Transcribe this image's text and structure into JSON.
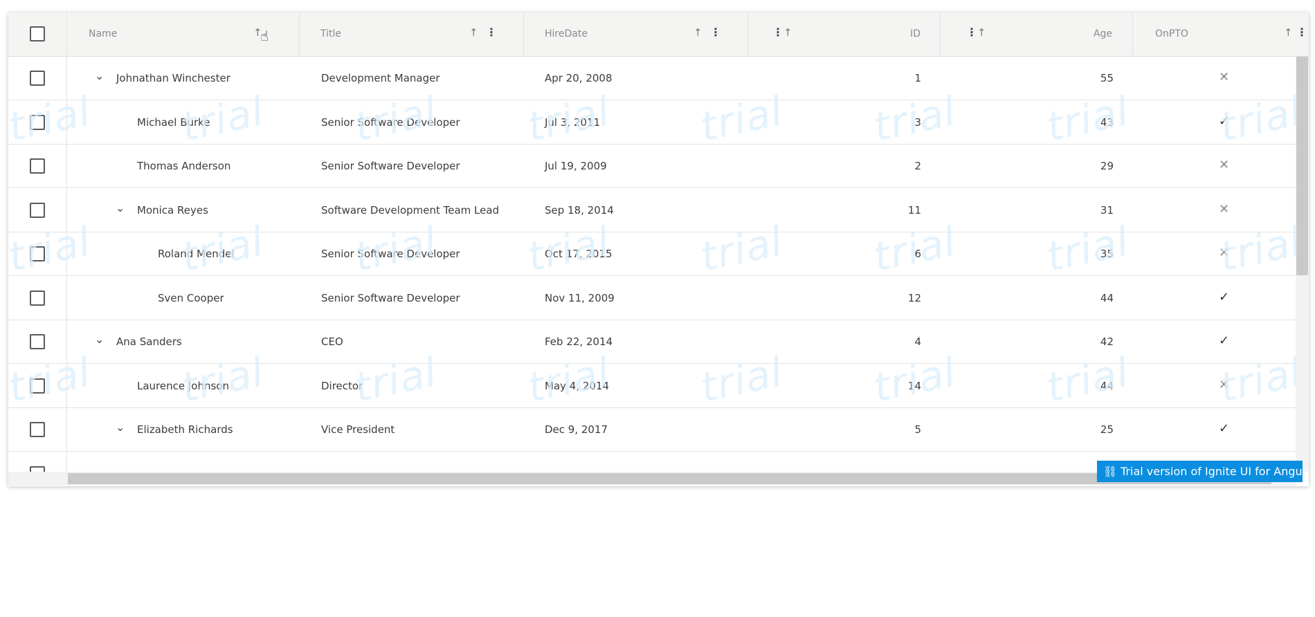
{
  "header": {
    "columns": [
      {
        "label": "Name",
        "sort_icon": "arrow-up-icon"
      },
      {
        "label": "Title",
        "sort_icon": "arrow-up-icon",
        "menu_icon": "more-vertical-icon"
      },
      {
        "label": "HireDate",
        "sort_icon": "arrow-up-icon",
        "menu_icon": "more-vertical-icon"
      },
      {
        "label": "ID",
        "sort_icon": "arrow-up-icon",
        "menu_icon": "more-vertical-icon"
      },
      {
        "label": "Age",
        "sort_icon": "arrow-up-icon",
        "menu_icon": "more-vertical-icon"
      },
      {
        "label": "OnPTO",
        "sort_icon": "arrow-up-icon",
        "menu_icon": "more-vertical-icon"
      }
    ]
  },
  "rows": [
    {
      "name": "Johnathan Winchester",
      "title": "Development Manager",
      "hire": "Apr 20, 2008",
      "id": "1",
      "age": "55",
      "pto": "✕",
      "level": 0,
      "expand": "⌄"
    },
    {
      "name": "Michael Burke",
      "title": "Senior Software Developer",
      "hire": "Jul 3, 2011",
      "id": "3",
      "age": "43",
      "pto": "✓",
      "level": 1,
      "expand": ""
    },
    {
      "name": "Thomas Anderson",
      "title": "Senior Software Developer",
      "hire": "Jul 19, 2009",
      "id": "2",
      "age": "29",
      "pto": "✕",
      "level": 1,
      "expand": ""
    },
    {
      "name": "Monica Reyes",
      "title": "Software Development Team Lead",
      "hire": "Sep 18, 2014",
      "id": "11",
      "age": "31",
      "pto": "✕",
      "level": 1,
      "expand": "⌄"
    },
    {
      "name": "Roland Mendel",
      "title": "Senior Software Developer",
      "hire": "Oct 17, 2015",
      "id": "6",
      "age": "35",
      "pto": "✕",
      "level": 2,
      "expand": ""
    },
    {
      "name": "Sven Cooper",
      "title": "Senior Software Developer",
      "hire": "Nov 11, 2009",
      "id": "12",
      "age": "44",
      "pto": "✓",
      "level": 2,
      "expand": ""
    },
    {
      "name": "Ana Sanders",
      "title": "CEO",
      "hire": "Feb 22, 2014",
      "id": "4",
      "age": "42",
      "pto": "✓",
      "level": 0,
      "expand": "⌄"
    },
    {
      "name": "Laurence Johnson",
      "title": "Director",
      "hire": "May 4, 2014",
      "id": "14",
      "age": "44",
      "pto": "✕",
      "level": 1,
      "expand": ""
    },
    {
      "name": "Elizabeth Richards",
      "title": "Vice President",
      "hire": "Dec 9, 2017",
      "id": "5",
      "age": "25",
      "pto": "✓",
      "level": 1,
      "expand": "⌄"
    }
  ],
  "watermark": "trial",
  "trial_badge": "Trial version of Ignite UI for Angular",
  "colors": {
    "badge": "#0b8ee0",
    "watermark": "#dbeefb"
  }
}
